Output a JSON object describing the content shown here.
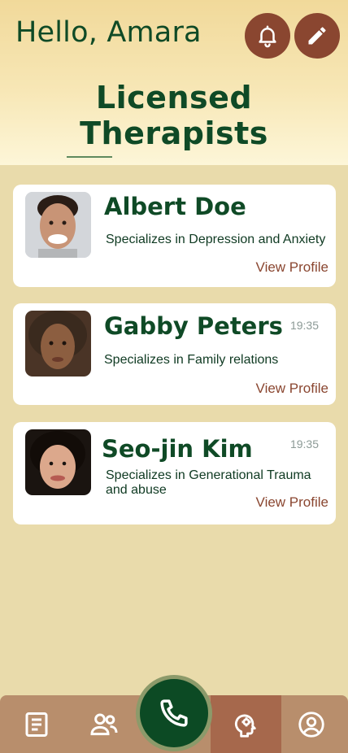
{
  "header": {
    "greeting": "Hello, Amara",
    "title": "Licensed Therapists",
    "notifications_icon": "bell-icon",
    "edit_icon": "pencil-icon"
  },
  "therapists": [
    {
      "name": "Albert Doe",
      "time": "",
      "specialty": "Specializes in Depression and Anxiety",
      "view_label": "View Profile"
    },
    {
      "name": "Gabby Peters",
      "time": "19:35",
      "specialty": "Specializes in Family relations",
      "view_label": "View Profile"
    },
    {
      "name": "Seo-jin Kim",
      "time": "19:35",
      "specialty": "Specializes in Generational Trauma and abuse",
      "view_label": "View Profile"
    }
  ],
  "bottom_nav": {
    "items": [
      "notes-icon",
      "people-icon",
      "phone-icon",
      "mind-icon",
      "profile-icon"
    ],
    "active": "mind-icon"
  },
  "colors": {
    "brand_green": "#0f4a26",
    "accent_brown": "#8a4630",
    "background": "#e9dbab",
    "nav": "#b88e6c"
  }
}
